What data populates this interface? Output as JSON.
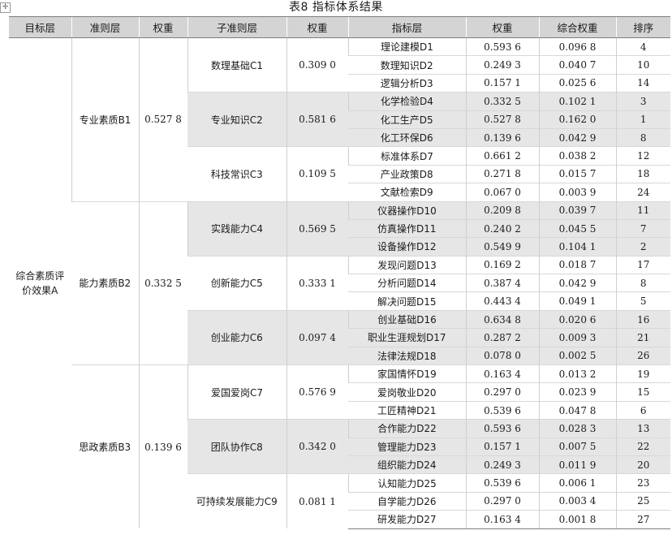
{
  "caption": "表8  指标体系结果",
  "move_icon": "move-handle-icon",
  "colors": {
    "header_bg": "#d4d4d4",
    "shaded_row_bg": "#e6e6e6"
  },
  "headers": [
    "目标层",
    "准则层",
    "权重",
    "子准则层",
    "权重",
    "指标层",
    "权重",
    "综合权重",
    "排序"
  ],
  "target": "综合素质评价效果A",
  "criteria": [
    {
      "name": "专业素质B1",
      "weight": "0.527 8",
      "subs": [
        {
          "name": "数理基础C1",
          "weight": "0.309 0",
          "shaded": false,
          "indicators": [
            {
              "name": "理论建模D1",
              "weight": "0.593 6",
              "composite": "0.096 8",
              "rank": "4"
            },
            {
              "name": "数理知识D2",
              "weight": "0.249 3",
              "composite": "0.040 7",
              "rank": "10"
            },
            {
              "name": "逻辑分析D3",
              "weight": "0.157 1",
              "composite": "0.025 6",
              "rank": "14"
            }
          ]
        },
        {
          "name": "专业知识C2",
          "weight": "0.581 6",
          "shaded": true,
          "indicators": [
            {
              "name": "化学检验D4",
              "weight": "0.332 5",
              "composite": "0.102 1",
              "rank": "3"
            },
            {
              "name": "化工生产D5",
              "weight": "0.527 8",
              "composite": "0.162 0",
              "rank": "1"
            },
            {
              "name": "化工环保D6",
              "weight": "0.139 6",
              "composite": "0.042 9",
              "rank": "8"
            }
          ]
        },
        {
          "name": "科技常识C3",
          "weight": "0.109 5",
          "shaded": false,
          "indicators": [
            {
              "name": "标准体系D7",
              "weight": "0.661 2",
              "composite": "0.038 2",
              "rank": "12"
            },
            {
              "name": "产业政策D8",
              "weight": "0.271 8",
              "composite": "0.015 7",
              "rank": "18"
            },
            {
              "name": "文献检索D9",
              "weight": "0.067 0",
              "composite": "0.003 9",
              "rank": "24"
            }
          ]
        }
      ]
    },
    {
      "name": "能力素质B2",
      "weight": "0.332 5",
      "subs": [
        {
          "name": "实践能力C4",
          "weight": "0.569 5",
          "shaded": true,
          "indicators": [
            {
              "name": "仪器操作D10",
              "weight": "0.209 8",
              "composite": "0.039 7",
              "rank": "11"
            },
            {
              "name": "仿真操作D11",
              "weight": "0.240 2",
              "composite": "0.045 5",
              "rank": "7"
            },
            {
              "name": "设备操作D12",
              "weight": "0.549 9",
              "composite": "0.104 1",
              "rank": "2"
            }
          ]
        },
        {
          "name": "创新能力C5",
          "weight": "0.333 1",
          "shaded": false,
          "indicators": [
            {
              "name": "发现问题D13",
              "weight": "0.169 2",
              "composite": "0.018 7",
              "rank": "17"
            },
            {
              "name": "分析问题D14",
              "weight": "0.387 4",
              "composite": "0.042 9",
              "rank": "8"
            },
            {
              "name": "解决问题D15",
              "weight": "0.443 4",
              "composite": "0.049 1",
              "rank": "5"
            }
          ]
        },
        {
          "name": "创业能力C6",
          "weight": "0.097 4",
          "shaded": true,
          "indicators": [
            {
              "name": "创业基础D16",
              "weight": "0.634 8",
              "composite": "0.020 6",
              "rank": "16"
            },
            {
              "name": "职业生涯规划D17",
              "weight": "0.287 2",
              "composite": "0.009 3",
              "rank": "21"
            },
            {
              "name": "法律法规D18",
              "weight": "0.078 0",
              "composite": "0.002 5",
              "rank": "26"
            }
          ]
        }
      ]
    },
    {
      "name": "思政素质B3",
      "weight": "0.139 6",
      "subs": [
        {
          "name": "爱国爱岗C7",
          "weight": "0.576 9",
          "shaded": false,
          "indicators": [
            {
              "name": "家国情怀D19",
              "weight": "0.163 4",
              "composite": "0.013 2",
              "rank": "19"
            },
            {
              "name": "爱岗敬业D20",
              "weight": "0.297 0",
              "composite": "0.023 9",
              "rank": "15"
            },
            {
              "name": "工匠精神D21",
              "weight": "0.539 6",
              "composite": "0.047 8",
              "rank": "6"
            }
          ]
        },
        {
          "name": "团队协作C8",
          "weight": "0.342 0",
          "shaded": true,
          "indicators": [
            {
              "name": "合作能力D22",
              "weight": "0.593 6",
              "composite": "0.028 3",
              "rank": "13"
            },
            {
              "name": "管理能力D23",
              "weight": "0.157 1",
              "composite": "0.007 5",
              "rank": "22"
            },
            {
              "name": "组织能力D24",
              "weight": "0.249 3",
              "composite": "0.011 9",
              "rank": "20"
            }
          ]
        },
        {
          "name": "可持续发展能力C9",
          "weight": "0.081 1",
          "shaded": false,
          "indicators": [
            {
              "name": "认知能力D25",
              "weight": "0.539 6",
              "composite": "0.006 1",
              "rank": "23"
            },
            {
              "name": "自学能力D26",
              "weight": "0.297 0",
              "composite": "0.003 4",
              "rank": "25"
            },
            {
              "name": "研发能力D27",
              "weight": "0.163 4",
              "composite": "0.001 8",
              "rank": "27"
            }
          ]
        }
      ]
    }
  ]
}
